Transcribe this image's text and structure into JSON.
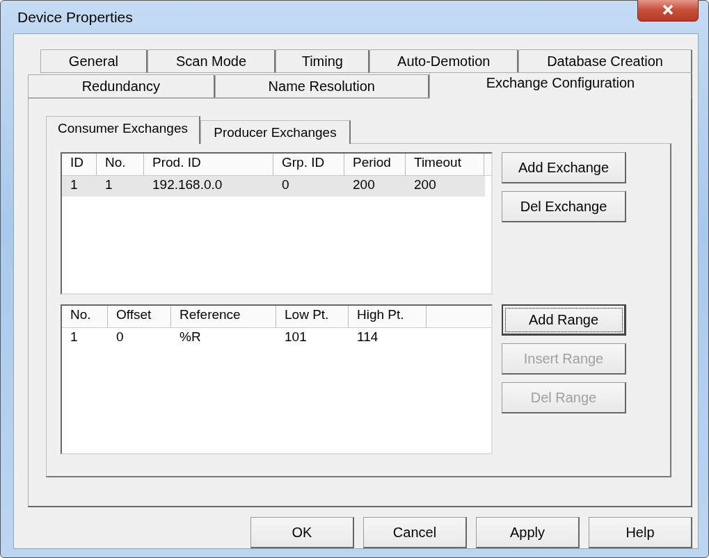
{
  "window": {
    "title": "Device Properties"
  },
  "tab_rows": [
    [
      {
        "label": "General",
        "selected": false
      },
      {
        "label": "Scan Mode",
        "selected": false
      },
      {
        "label": "Timing",
        "selected": false
      },
      {
        "label": "Auto-Demotion",
        "selected": false
      },
      {
        "label": "Database Creation",
        "selected": false
      }
    ],
    [
      {
        "label": "Redundancy",
        "selected": false
      },
      {
        "label": "Name Resolution",
        "selected": false
      },
      {
        "label": "Exchange Configuration",
        "selected": true
      }
    ]
  ],
  "subtabs": [
    {
      "label": "Consumer Exchanges",
      "selected": true
    },
    {
      "label": "Producer Exchanges",
      "selected": false
    }
  ],
  "exchanges_table": {
    "columns": [
      "ID",
      "No.",
      "Prod. ID",
      "Grp. ID",
      "Period",
      "Timeout"
    ],
    "rows": [
      {
        "cells": [
          "1",
          "1",
          "192.168.0.0",
          "0",
          "200",
          "200"
        ],
        "selected": true
      }
    ]
  },
  "exchange_buttons": [
    {
      "label": "Add  Exchange",
      "disabled": false,
      "focused": false
    },
    {
      "label": "Del Exchange",
      "disabled": false,
      "focused": false
    }
  ],
  "ranges_table": {
    "columns": [
      "No.",
      "Offset",
      "Reference",
      "Low Pt.",
      "High Pt."
    ],
    "rows": [
      {
        "cells": [
          "1",
          "0",
          "%R",
          "101",
          "114"
        ],
        "selected": false
      }
    ]
  },
  "range_buttons": [
    {
      "label": "Add Range",
      "disabled": false,
      "focused": true
    },
    {
      "label": "Insert Range",
      "disabled": true,
      "focused": false
    },
    {
      "label": "Del Range",
      "disabled": true,
      "focused": false
    }
  ],
  "dialog_buttons": [
    "OK",
    "Cancel",
    "Apply",
    "Help"
  ]
}
